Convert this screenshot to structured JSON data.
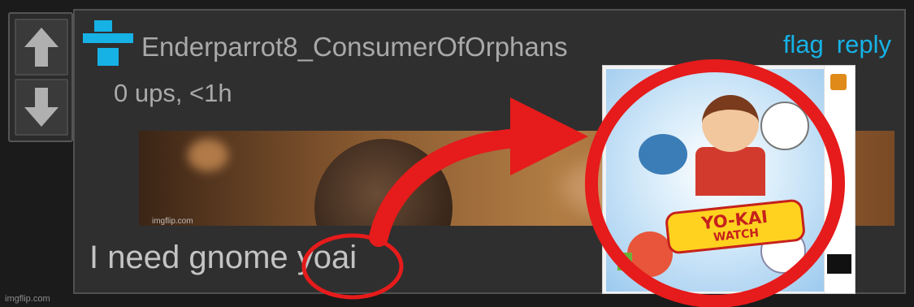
{
  "comment": {
    "username": "Enderparrot8_ConsumerOfOrphans",
    "meta": "0 ups, <1h",
    "actions": {
      "flag": "flag",
      "reply": "reply"
    },
    "text": "I need gnome yoai",
    "image_watermark": "imgflip.com"
  },
  "overlay": {
    "game_cover": {
      "title_line1": "YO-KAI",
      "title_line2": "WATCH"
    }
  },
  "footer": {
    "watermark": "imgflip.com"
  },
  "colors": {
    "accent": "#16b2e6",
    "circle": "#e61b1b",
    "background": "#1b1b1b",
    "card": "#2f2f2f"
  },
  "icons": {
    "vote_up": "arrow-up-icon",
    "vote_down": "arrow-down-icon",
    "user": "user-avatar-icon",
    "arrow": "curved-arrow-icon"
  }
}
